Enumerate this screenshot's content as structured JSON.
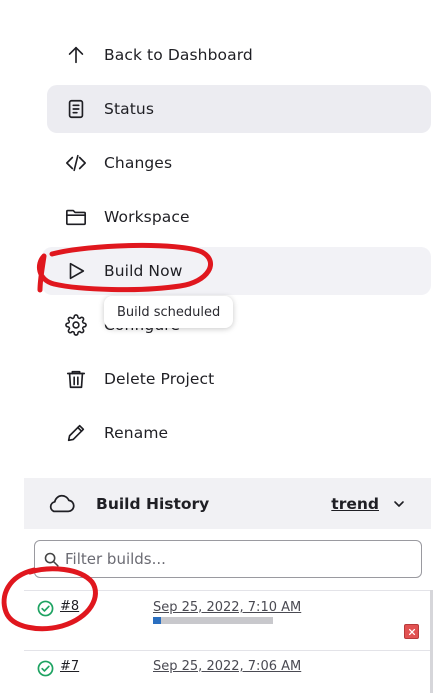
{
  "tasks": [
    {
      "label": "Back to Dashboard",
      "icon": "arrow-up-icon"
    },
    {
      "label": "Status",
      "icon": "document-icon"
    },
    {
      "label": "Changes",
      "icon": "code-icon"
    },
    {
      "label": "Workspace",
      "icon": "folder-icon"
    },
    {
      "label": "Build Now",
      "icon": "play-icon"
    },
    {
      "label": "Configure",
      "icon": "gear-icon"
    },
    {
      "label": "Delete Project",
      "icon": "trash-icon"
    },
    {
      "label": "Rename",
      "icon": "pencil-icon"
    }
  ],
  "tooltip": {
    "text": "Build scheduled"
  },
  "build_history": {
    "title": "Build History",
    "trend_label": "trend",
    "filter_placeholder": "Filter builds...",
    "builds": [
      {
        "number": "#8",
        "date": "Sep 25, 2022, 7:10 AM",
        "status": "success",
        "in_progress": true,
        "progress": 0.07
      },
      {
        "number": "#7",
        "date": "Sep 25, 2022, 7:06 AM",
        "status": "success",
        "in_progress": false
      }
    ]
  },
  "colors": {
    "active_bg": "#ececf1",
    "success": "#1ea362",
    "progress_fill": "#2a6fc0",
    "annotation": "#e0171e"
  }
}
